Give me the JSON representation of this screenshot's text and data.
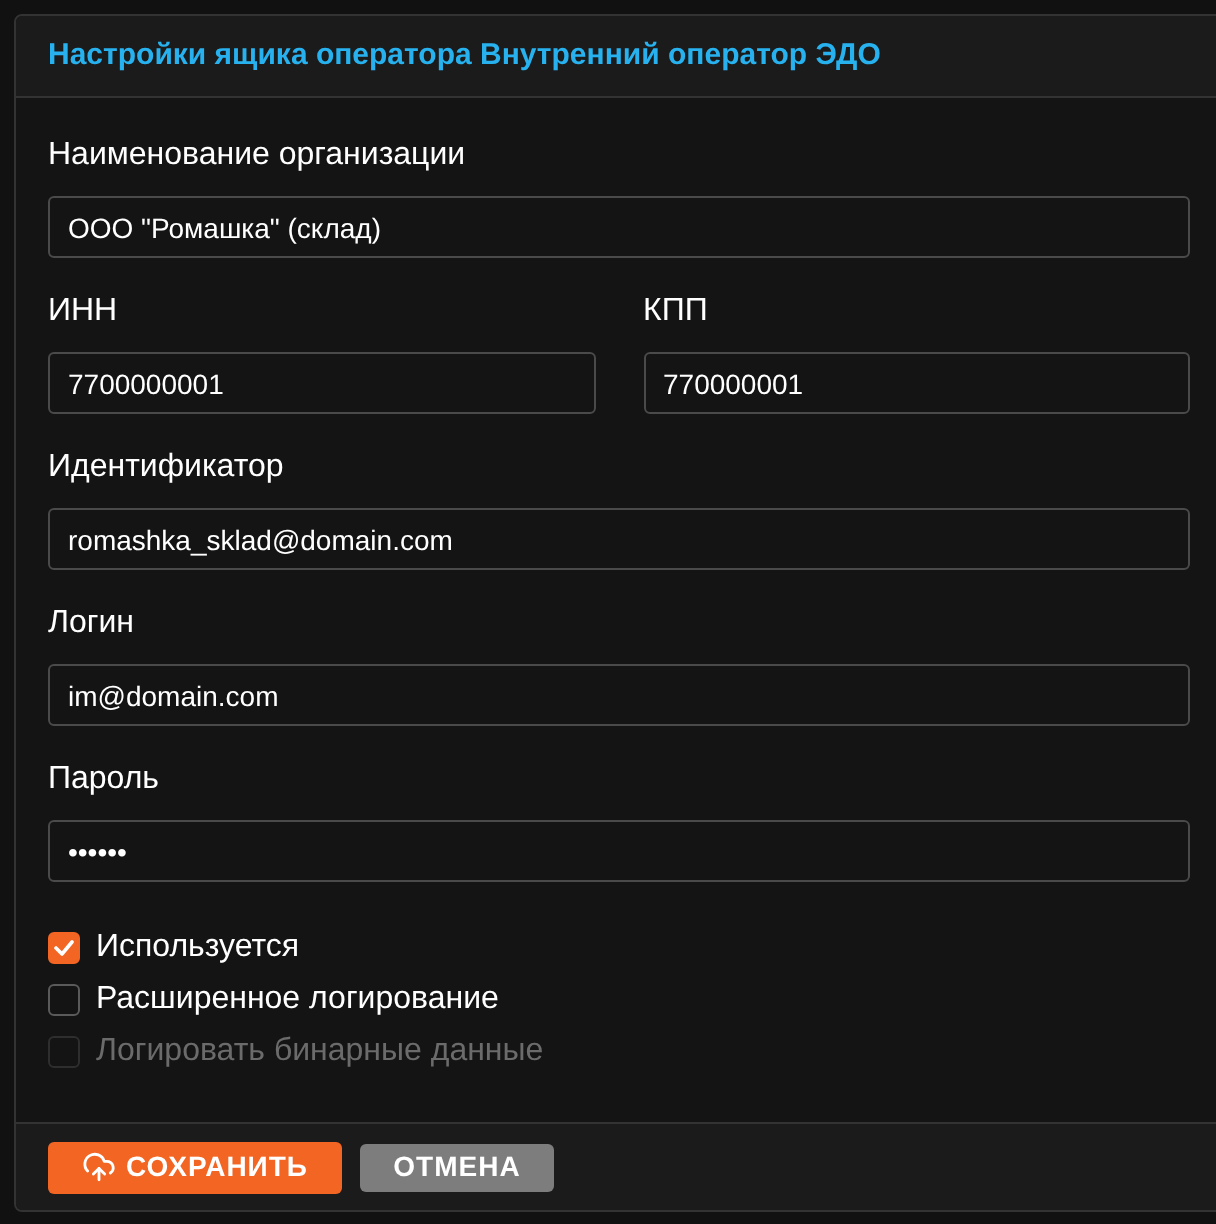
{
  "panel": {
    "title": "Настройки ящика оператора Внутренний оператор ЭДО"
  },
  "rows": [
    {
      "fields": [
        {
          "label": "Наименование организации",
          "value": "ООО \"Ромашка\" (склад)"
        }
      ]
    },
    {
      "fields": [
        {
          "label": "ИНН",
          "value": "7700000001"
        },
        {
          "label": "КПП",
          "value": "770000001"
        }
      ]
    },
    {
      "fields": [
        {
          "label": "Идентификатор",
          "value": "romashka_sklad@domain.com"
        }
      ]
    },
    {
      "fields": [
        {
          "label": "Логин",
          "value": "im@domain.com"
        }
      ]
    },
    {
      "fields": [
        {
          "label": "Пароль",
          "value": "••••••"
        }
      ]
    }
  ],
  "checkboxes": [
    {
      "label": "Используется",
      "checked": true,
      "disabled": false
    },
    {
      "label": "Расширенное логирование",
      "checked": false,
      "disabled": false
    },
    {
      "label": "Логировать бинарные данные",
      "checked": false,
      "disabled": true
    }
  ],
  "buttons": [
    {
      "label": "СОХРАНИТЬ",
      "kind": "primary"
    },
    {
      "label": "ОТМЕНА",
      "kind": "secondary"
    }
  ]
}
